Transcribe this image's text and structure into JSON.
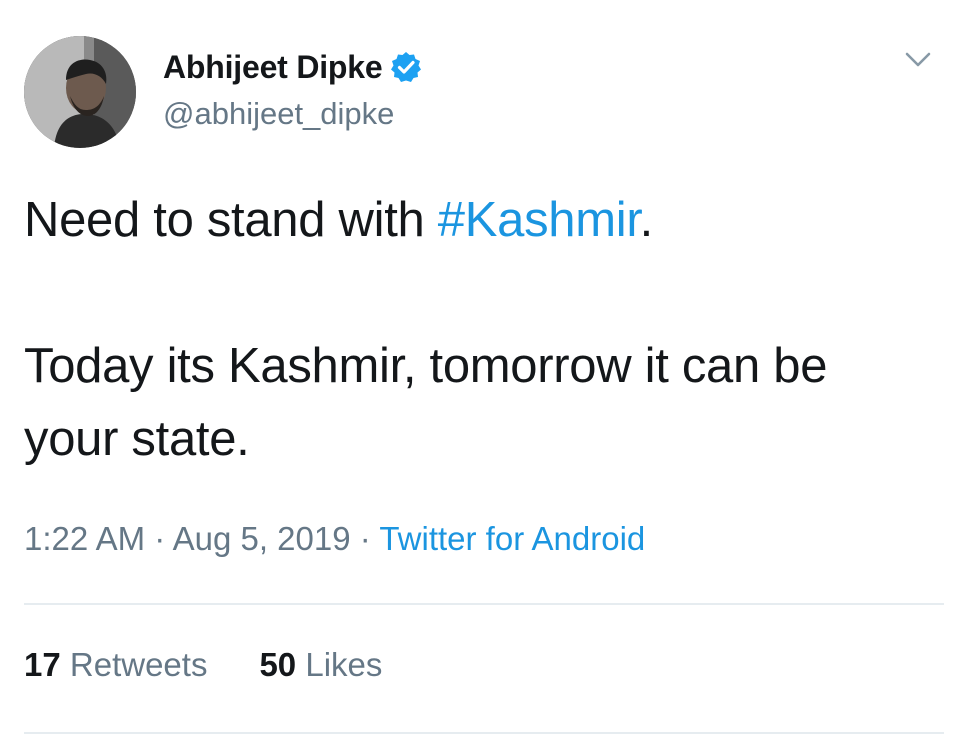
{
  "author": {
    "display_name": "Abhijeet Dipke",
    "handle": "@abhijeet_dipke",
    "verified_icon": "verified-badge-icon",
    "avatar_icon": "profile-photo"
  },
  "tweet": {
    "line1_prefix": "Need to stand with ",
    "hashtag": "#Kashmir",
    "line1_suffix": ".",
    "line2": "Today its Kashmir, tomorrow it can be your state."
  },
  "meta": {
    "time": "1:22 AM",
    "separator": " · ",
    "date": "Aug 5, 2019",
    "source": "Twitter for Android"
  },
  "stats": {
    "retweets_count": "17",
    "retweets_label": "Retweets",
    "likes_count": "50",
    "likes_label": "Likes"
  },
  "colors": {
    "link": "#1b95e0",
    "secondary_text": "#657786",
    "primary_text": "#14171a",
    "divider": "#e6ecf0"
  },
  "icons": {
    "menu": "chevron-down-icon"
  }
}
